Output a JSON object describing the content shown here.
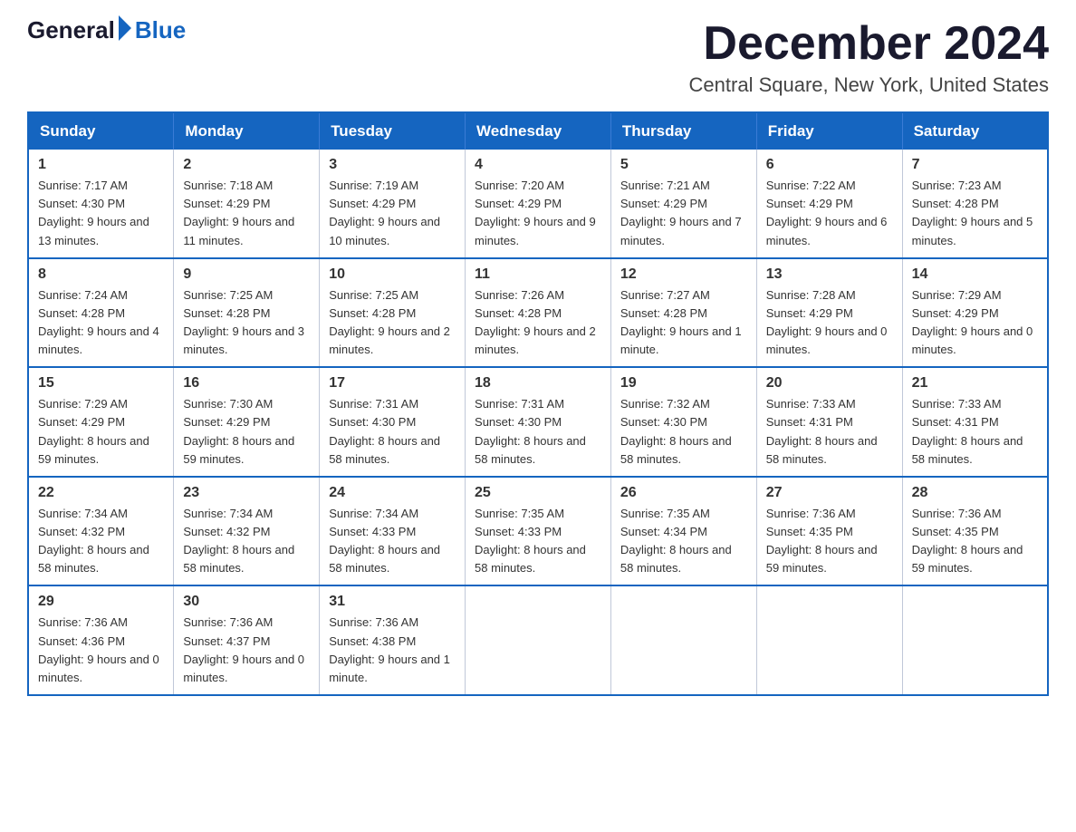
{
  "logo": {
    "general": "General",
    "blue": "Blue"
  },
  "title": {
    "month": "December 2024",
    "location": "Central Square, New York, United States"
  },
  "weekdays": [
    "Sunday",
    "Monday",
    "Tuesday",
    "Wednesday",
    "Thursday",
    "Friday",
    "Saturday"
  ],
  "weeks": [
    [
      {
        "day": "1",
        "sunrise": "7:17 AM",
        "sunset": "4:30 PM",
        "daylight": "9 hours and 13 minutes."
      },
      {
        "day": "2",
        "sunrise": "7:18 AM",
        "sunset": "4:29 PM",
        "daylight": "9 hours and 11 minutes."
      },
      {
        "day": "3",
        "sunrise": "7:19 AM",
        "sunset": "4:29 PM",
        "daylight": "9 hours and 10 minutes."
      },
      {
        "day": "4",
        "sunrise": "7:20 AM",
        "sunset": "4:29 PM",
        "daylight": "9 hours and 9 minutes."
      },
      {
        "day": "5",
        "sunrise": "7:21 AM",
        "sunset": "4:29 PM",
        "daylight": "9 hours and 7 minutes."
      },
      {
        "day": "6",
        "sunrise": "7:22 AM",
        "sunset": "4:29 PM",
        "daylight": "9 hours and 6 minutes."
      },
      {
        "day": "7",
        "sunrise": "7:23 AM",
        "sunset": "4:28 PM",
        "daylight": "9 hours and 5 minutes."
      }
    ],
    [
      {
        "day": "8",
        "sunrise": "7:24 AM",
        "sunset": "4:28 PM",
        "daylight": "9 hours and 4 minutes."
      },
      {
        "day": "9",
        "sunrise": "7:25 AM",
        "sunset": "4:28 PM",
        "daylight": "9 hours and 3 minutes."
      },
      {
        "day": "10",
        "sunrise": "7:25 AM",
        "sunset": "4:28 PM",
        "daylight": "9 hours and 2 minutes."
      },
      {
        "day": "11",
        "sunrise": "7:26 AM",
        "sunset": "4:28 PM",
        "daylight": "9 hours and 2 minutes."
      },
      {
        "day": "12",
        "sunrise": "7:27 AM",
        "sunset": "4:28 PM",
        "daylight": "9 hours and 1 minute."
      },
      {
        "day": "13",
        "sunrise": "7:28 AM",
        "sunset": "4:29 PM",
        "daylight": "9 hours and 0 minutes."
      },
      {
        "day": "14",
        "sunrise": "7:29 AM",
        "sunset": "4:29 PM",
        "daylight": "9 hours and 0 minutes."
      }
    ],
    [
      {
        "day": "15",
        "sunrise": "7:29 AM",
        "sunset": "4:29 PM",
        "daylight": "8 hours and 59 minutes."
      },
      {
        "day": "16",
        "sunrise": "7:30 AM",
        "sunset": "4:29 PM",
        "daylight": "8 hours and 59 minutes."
      },
      {
        "day": "17",
        "sunrise": "7:31 AM",
        "sunset": "4:30 PM",
        "daylight": "8 hours and 58 minutes."
      },
      {
        "day": "18",
        "sunrise": "7:31 AM",
        "sunset": "4:30 PM",
        "daylight": "8 hours and 58 minutes."
      },
      {
        "day": "19",
        "sunrise": "7:32 AM",
        "sunset": "4:30 PM",
        "daylight": "8 hours and 58 minutes."
      },
      {
        "day": "20",
        "sunrise": "7:33 AM",
        "sunset": "4:31 PM",
        "daylight": "8 hours and 58 minutes."
      },
      {
        "day": "21",
        "sunrise": "7:33 AM",
        "sunset": "4:31 PM",
        "daylight": "8 hours and 58 minutes."
      }
    ],
    [
      {
        "day": "22",
        "sunrise": "7:34 AM",
        "sunset": "4:32 PM",
        "daylight": "8 hours and 58 minutes."
      },
      {
        "day": "23",
        "sunrise": "7:34 AM",
        "sunset": "4:32 PM",
        "daylight": "8 hours and 58 minutes."
      },
      {
        "day": "24",
        "sunrise": "7:34 AM",
        "sunset": "4:33 PM",
        "daylight": "8 hours and 58 minutes."
      },
      {
        "day": "25",
        "sunrise": "7:35 AM",
        "sunset": "4:33 PM",
        "daylight": "8 hours and 58 minutes."
      },
      {
        "day": "26",
        "sunrise": "7:35 AM",
        "sunset": "4:34 PM",
        "daylight": "8 hours and 58 minutes."
      },
      {
        "day": "27",
        "sunrise": "7:36 AM",
        "sunset": "4:35 PM",
        "daylight": "8 hours and 59 minutes."
      },
      {
        "day": "28",
        "sunrise": "7:36 AM",
        "sunset": "4:35 PM",
        "daylight": "8 hours and 59 minutes."
      }
    ],
    [
      {
        "day": "29",
        "sunrise": "7:36 AM",
        "sunset": "4:36 PM",
        "daylight": "9 hours and 0 minutes."
      },
      {
        "day": "30",
        "sunrise": "7:36 AM",
        "sunset": "4:37 PM",
        "daylight": "9 hours and 0 minutes."
      },
      {
        "day": "31",
        "sunrise": "7:36 AM",
        "sunset": "4:38 PM",
        "daylight": "9 hours and 1 minute."
      },
      null,
      null,
      null,
      null
    ]
  ]
}
